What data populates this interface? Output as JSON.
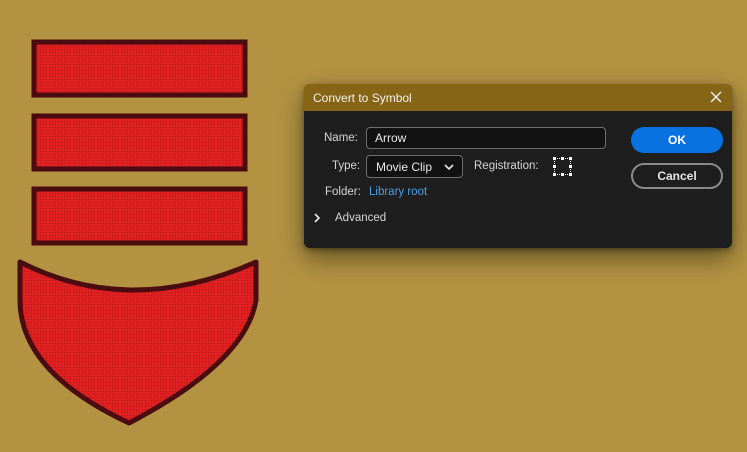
{
  "colors": {
    "stage_background": "#b39342",
    "shape_fill": "#e02020",
    "shape_outline": "#4a0c10",
    "dialog_background": "#1e1e1e",
    "titlebar": "#866517",
    "accent": "#0a72e0",
    "link": "#4a9fe8"
  },
  "dialog": {
    "title": "Convert to Symbol",
    "close_icon": "close-icon",
    "name_label": "Name:",
    "name_value": "Arrow",
    "type_label": "Type:",
    "type_value": "Movie Clip",
    "type_icon": "chevron-down-icon",
    "registration_label": "Registration:",
    "registration_icon": "registration-grid-icon",
    "folder_label": "Folder:",
    "folder_value": "Library root",
    "advanced_label": "Advanced",
    "advanced_icon": "chevron-right-icon",
    "ok_label": "OK",
    "cancel_label": "Cancel"
  }
}
